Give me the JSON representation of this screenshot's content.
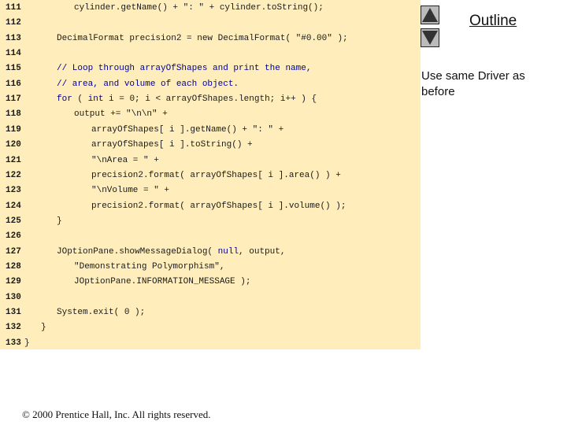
{
  "slide": {
    "outline_label": "Outline",
    "side_note": "Use same Driver as before",
    "footer": "© 2000 Prentice Hall, Inc.  All rights reserved.",
    "nav": {
      "prev_icon": "triangle-up-icon",
      "next_icon": "triangle-down-icon"
    },
    "colors": {
      "code_background": "#ffeebb",
      "keyword": "#000099",
      "nav_button": "#bbbbbb"
    }
  },
  "code_lines": [
    {
      "num": "111",
      "parts": [
        {
          "t": "cylinder.getName() + \": \" + cylinder.toString();"
        }
      ]
    },
    {
      "num": "112",
      "parts": []
    },
    {
      "num": "113",
      "parts": [
        {
          "t": "DecimalFormat precision2 = new DecimalFormat( \"#0.00\" );"
        }
      ]
    },
    {
      "num": "114",
      "parts": []
    },
    {
      "num": "115",
      "parts": [
        {
          "t": "// Loop through arrayOfShapes and print the name,",
          "c": "cmt"
        }
      ]
    },
    {
      "num": "116",
      "parts": [
        {
          "t": "// area, and volume of each object.",
          "c": "cmt"
        }
      ]
    },
    {
      "num": "117",
      "parts": [
        {
          "t": "for",
          "c": "kw"
        },
        {
          "t": " ( "
        },
        {
          "t": "int",
          "c": "kw"
        },
        {
          "t": " i = 0; i < arrayOfShapes.length; i++ ) {"
        }
      ]
    },
    {
      "num": "118",
      "parts": [
        {
          "t": "output += \"\\n\\n\" +"
        }
      ]
    },
    {
      "num": "119",
      "parts": [
        {
          "t": "arrayOfShapes[ i ].getName() + \": \" +"
        }
      ]
    },
    {
      "num": "120",
      "parts": [
        {
          "t": "arrayOfShapes[ i ].toString() +"
        }
      ]
    },
    {
      "num": "121",
      "parts": [
        {
          "t": "\"\\nArea = \" +"
        }
      ]
    },
    {
      "num": "122",
      "parts": [
        {
          "t": "precision2.format( arrayOfShapes[ i ].area() ) +"
        }
      ]
    },
    {
      "num": "123",
      "parts": [
        {
          "t": "\"\\nVolume = \" +"
        }
      ]
    },
    {
      "num": "124",
      "parts": [
        {
          "t": "precision2.format( arrayOfShapes[ i ].volume() );"
        }
      ]
    },
    {
      "num": "125",
      "parts": [
        {
          "t": "}"
        }
      ]
    },
    {
      "num": "126",
      "parts": []
    },
    {
      "num": "127",
      "parts": [
        {
          "t": "JOptionPane.showMessageDialog( "
        },
        {
          "t": "null",
          "c": "kw"
        },
        {
          "t": ", output,"
        }
      ]
    },
    {
      "num": "128",
      "parts": [
        {
          "t": "\"Demonstrating Polymorphism\","
        }
      ]
    },
    {
      "num": "129",
      "parts": [
        {
          "t": "JOptionPane.INFORMATION_MESSAGE );"
        }
      ]
    },
    {
      "num": "130",
      "parts": []
    },
    {
      "num": "131",
      "parts": [
        {
          "t": "System.exit( 0 );"
        }
      ]
    },
    {
      "num": "132",
      "parts": [
        {
          "t": "}"
        }
      ]
    },
    {
      "num": "133",
      "parts": [
        {
          "t": "}"
        }
      ]
    }
  ]
}
